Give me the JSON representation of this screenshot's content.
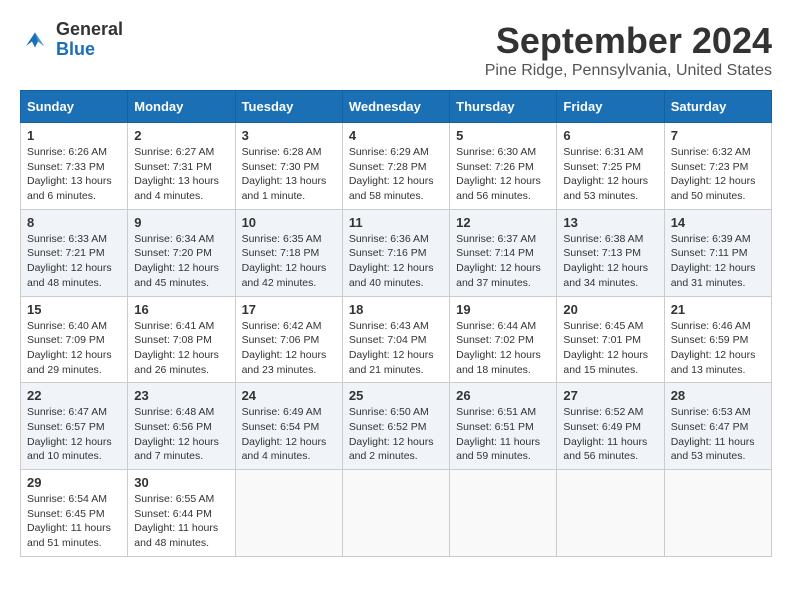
{
  "logo": {
    "general": "General",
    "blue": "Blue"
  },
  "title": "September 2024",
  "location": "Pine Ridge, Pennsylvania, United States",
  "weekdays": [
    "Sunday",
    "Monday",
    "Tuesday",
    "Wednesday",
    "Thursday",
    "Friday",
    "Saturday"
  ],
  "weeks": [
    [
      {
        "day": "1",
        "info": "Sunrise: 6:26 AM\nSunset: 7:33 PM\nDaylight: 13 hours\nand 6 minutes."
      },
      {
        "day": "2",
        "info": "Sunrise: 6:27 AM\nSunset: 7:31 PM\nDaylight: 13 hours\nand 4 minutes."
      },
      {
        "day": "3",
        "info": "Sunrise: 6:28 AM\nSunset: 7:30 PM\nDaylight: 13 hours\nand 1 minute."
      },
      {
        "day": "4",
        "info": "Sunrise: 6:29 AM\nSunset: 7:28 PM\nDaylight: 12 hours\nand 58 minutes."
      },
      {
        "day": "5",
        "info": "Sunrise: 6:30 AM\nSunset: 7:26 PM\nDaylight: 12 hours\nand 56 minutes."
      },
      {
        "day": "6",
        "info": "Sunrise: 6:31 AM\nSunset: 7:25 PM\nDaylight: 12 hours\nand 53 minutes."
      },
      {
        "day": "7",
        "info": "Sunrise: 6:32 AM\nSunset: 7:23 PM\nDaylight: 12 hours\nand 50 minutes."
      }
    ],
    [
      {
        "day": "8",
        "info": "Sunrise: 6:33 AM\nSunset: 7:21 PM\nDaylight: 12 hours\nand 48 minutes."
      },
      {
        "day": "9",
        "info": "Sunrise: 6:34 AM\nSunset: 7:20 PM\nDaylight: 12 hours\nand 45 minutes."
      },
      {
        "day": "10",
        "info": "Sunrise: 6:35 AM\nSunset: 7:18 PM\nDaylight: 12 hours\nand 42 minutes."
      },
      {
        "day": "11",
        "info": "Sunrise: 6:36 AM\nSunset: 7:16 PM\nDaylight: 12 hours\nand 40 minutes."
      },
      {
        "day": "12",
        "info": "Sunrise: 6:37 AM\nSunset: 7:14 PM\nDaylight: 12 hours\nand 37 minutes."
      },
      {
        "day": "13",
        "info": "Sunrise: 6:38 AM\nSunset: 7:13 PM\nDaylight: 12 hours\nand 34 minutes."
      },
      {
        "day": "14",
        "info": "Sunrise: 6:39 AM\nSunset: 7:11 PM\nDaylight: 12 hours\nand 31 minutes."
      }
    ],
    [
      {
        "day": "15",
        "info": "Sunrise: 6:40 AM\nSunset: 7:09 PM\nDaylight: 12 hours\nand 29 minutes."
      },
      {
        "day": "16",
        "info": "Sunrise: 6:41 AM\nSunset: 7:08 PM\nDaylight: 12 hours\nand 26 minutes."
      },
      {
        "day": "17",
        "info": "Sunrise: 6:42 AM\nSunset: 7:06 PM\nDaylight: 12 hours\nand 23 minutes."
      },
      {
        "day": "18",
        "info": "Sunrise: 6:43 AM\nSunset: 7:04 PM\nDaylight: 12 hours\nand 21 minutes."
      },
      {
        "day": "19",
        "info": "Sunrise: 6:44 AM\nSunset: 7:02 PM\nDaylight: 12 hours\nand 18 minutes."
      },
      {
        "day": "20",
        "info": "Sunrise: 6:45 AM\nSunset: 7:01 PM\nDaylight: 12 hours\nand 15 minutes."
      },
      {
        "day": "21",
        "info": "Sunrise: 6:46 AM\nSunset: 6:59 PM\nDaylight: 12 hours\nand 13 minutes."
      }
    ],
    [
      {
        "day": "22",
        "info": "Sunrise: 6:47 AM\nSunset: 6:57 PM\nDaylight: 12 hours\nand 10 minutes."
      },
      {
        "day": "23",
        "info": "Sunrise: 6:48 AM\nSunset: 6:56 PM\nDaylight: 12 hours\nand 7 minutes."
      },
      {
        "day": "24",
        "info": "Sunrise: 6:49 AM\nSunset: 6:54 PM\nDaylight: 12 hours\nand 4 minutes."
      },
      {
        "day": "25",
        "info": "Sunrise: 6:50 AM\nSunset: 6:52 PM\nDaylight: 12 hours\nand 2 minutes."
      },
      {
        "day": "26",
        "info": "Sunrise: 6:51 AM\nSunset: 6:51 PM\nDaylight: 11 hours\nand 59 minutes."
      },
      {
        "day": "27",
        "info": "Sunrise: 6:52 AM\nSunset: 6:49 PM\nDaylight: 11 hours\nand 56 minutes."
      },
      {
        "day": "28",
        "info": "Sunrise: 6:53 AM\nSunset: 6:47 PM\nDaylight: 11 hours\nand 53 minutes."
      }
    ],
    [
      {
        "day": "29",
        "info": "Sunrise: 6:54 AM\nSunset: 6:45 PM\nDaylight: 11 hours\nand 51 minutes."
      },
      {
        "day": "30",
        "info": "Sunrise: 6:55 AM\nSunset: 6:44 PM\nDaylight: 11 hours\nand 48 minutes."
      },
      null,
      null,
      null,
      null,
      null
    ]
  ]
}
